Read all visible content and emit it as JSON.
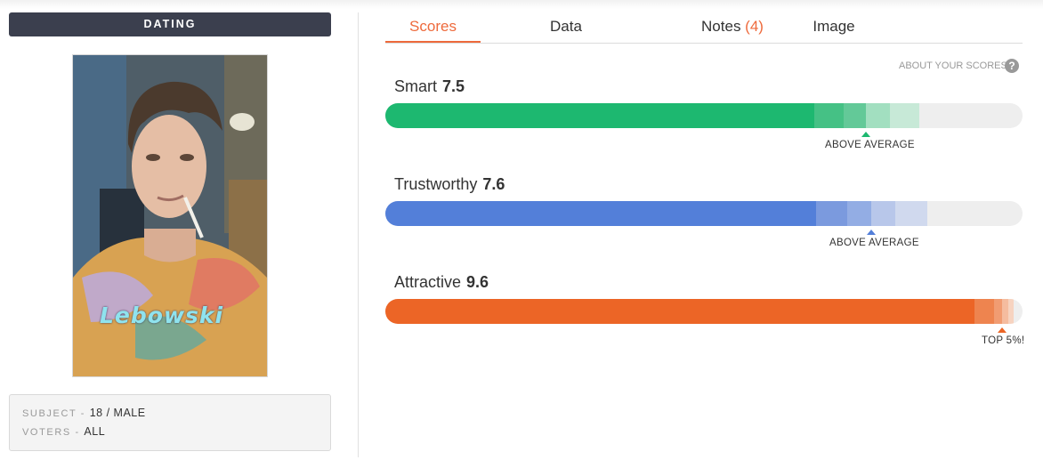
{
  "sidebar": {
    "category": "DATING",
    "photo_caption": "Lebowski",
    "info": {
      "subject_key": "SUBJECT - ",
      "subject_value": "18 / MALE",
      "voters_key": "VOTERS - ",
      "voters_value": "ALL"
    }
  },
  "tabs": [
    {
      "label": "Scores",
      "active": true
    },
    {
      "label": "Data",
      "active": false
    },
    {
      "label": "Notes ",
      "count": "(4)",
      "active": false
    },
    {
      "label": "Image",
      "active": false
    }
  ],
  "about_scores": "ABOUT YOUR SCORES",
  "help_icon": "?",
  "scores": [
    {
      "label": "Smart",
      "value": "7.5",
      "rating": "ABOVE AVERAGE",
      "color": "#1db870"
    },
    {
      "label": "Trustworthy",
      "value": "7.6",
      "rating": "ABOVE AVERAGE",
      "color": "#537fd9"
    },
    {
      "label": "Attractive",
      "value": "9.6",
      "rating": "TOP 5%!",
      "color": "#ec6526"
    }
  ],
  "colors": {
    "accent": "#ee6a3c",
    "header_bg": "#3b3f4e"
  }
}
